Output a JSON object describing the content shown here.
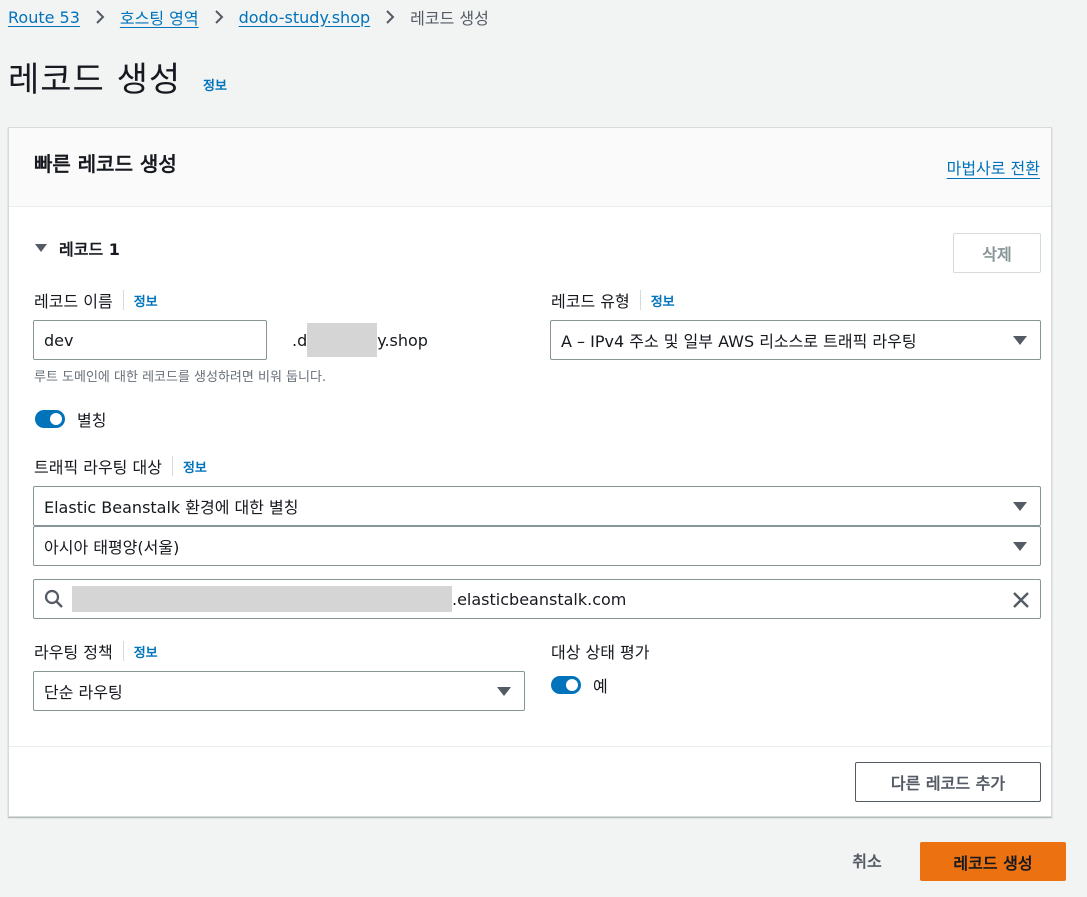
{
  "breadcrumb": {
    "items": [
      "Route 53",
      "호스팅 영역",
      "dodo-study.shop"
    ],
    "current": "레코드 생성"
  },
  "page": {
    "title": "레코드 생성",
    "info": "정보"
  },
  "panel": {
    "title": "빠른 레코드 생성",
    "wizard_link": "마법사로 전환",
    "record_title": "레코드 1",
    "delete_label": "삭제",
    "add_record_label": "다른 레코드 추가"
  },
  "record_name": {
    "label": "레코드 이름",
    "info": "정보",
    "value": "dev",
    "suffix_start": ".d",
    "suffix_end": "y.shop",
    "hint": "루트 도메인에 대한 레코드를 생성하려면 비워 둡니다."
  },
  "record_type": {
    "label": "레코드 유형",
    "info": "정보",
    "value": "A – IPv4 주소 및 일부 AWS 리소스로 트래픽 라우팅"
  },
  "alias": {
    "label": "별칭",
    "enabled": true
  },
  "traffic_target": {
    "label": "트래픽 라우팅 대상",
    "info": "정보",
    "endpoint_type": "Elastic Beanstalk 환경에 대한 별칭",
    "region": "아시아 태평양(서울)",
    "environment_suffix": ".elasticbeanstalk.com"
  },
  "routing_policy": {
    "label": "라우팅 정책",
    "info": "정보",
    "value": "단순 라우팅"
  },
  "health_check": {
    "label": "대상 상태 평가",
    "value": "예",
    "enabled": true
  },
  "actions": {
    "cancel_label": "취소",
    "create_label": "레코드 생성"
  },
  "colors": {
    "link": "#0073bb",
    "primary": "#ec7211",
    "toggle_on": "#0073bb"
  },
  "icons": [
    "chevron-right-icon",
    "caret-down-icon",
    "search-icon",
    "close-icon"
  ]
}
